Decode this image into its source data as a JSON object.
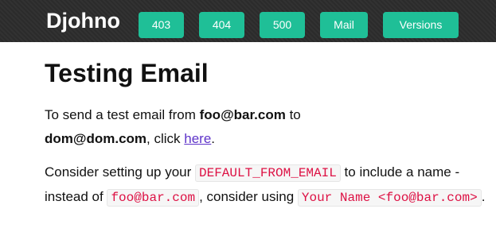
{
  "navbar": {
    "brand": "Djohno",
    "buttons": [
      "403",
      "404",
      "500",
      "Mail",
      "Versions"
    ]
  },
  "page": {
    "title": "Testing Email",
    "p1": {
      "prefix": "To send a test email from ",
      "from_email": "foo@bar.com",
      "to_word": " to",
      "to_email": "dom@dom.com",
      "click_text": ", click ",
      "link_text": "here",
      "end": "."
    },
    "p2": {
      "prefix": "Consider setting up your ",
      "setting": "DEFAULT_FROM_EMAIL",
      "middle": " to include a name - instead of ",
      "example": "foo@bar.com",
      "consider": ", consider using ",
      "suggestion": "Your Name <foo@bar.com>",
      "end": "."
    }
  },
  "colors": {
    "navbar_bg": "#2b2b2b",
    "button_bg": "#1fbf97",
    "code_text": "#dd1144",
    "link": "#5e33c9"
  }
}
